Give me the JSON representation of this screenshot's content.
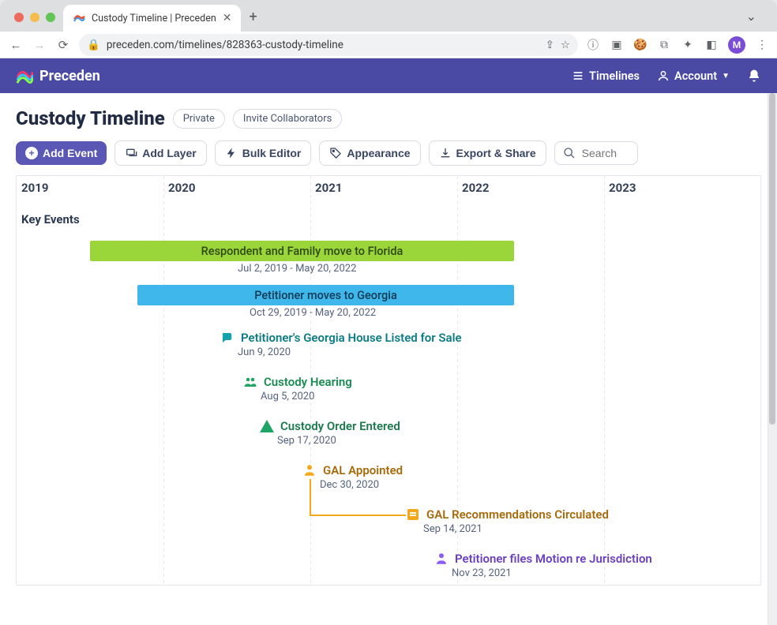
{
  "browser": {
    "tab_title": "Custody Timeline | Preceden",
    "url": "preceden.com/timelines/828363-custody-timeline",
    "avatar_letter": "M"
  },
  "header": {
    "brand": "Preceden",
    "timelines": "Timelines",
    "account": "Account"
  },
  "page": {
    "title": "Custody Timeline",
    "privacy": "Private",
    "invite": "Invite Collaborators"
  },
  "toolbar": {
    "add_event": "Add Event",
    "add_layer": "Add Layer",
    "bulk_editor": "Bulk Editor",
    "appearance": "Appearance",
    "export_share": "Export & Share",
    "search_placeholder": "Search"
  },
  "timeline": {
    "years": [
      "2019",
      "2020",
      "2021",
      "2022",
      "2023"
    ],
    "track_label": "Key Events",
    "bars": [
      {
        "label": "Respondent and Family move to Florida",
        "date": "Jul 2, 2019 - May 20, 2022",
        "start": "2019-07-02",
        "end": "2022-05-20",
        "color": "green"
      },
      {
        "label": "Petitioner moves to Georgia",
        "date": "Oct 29, 2019 - May 20, 2022",
        "start": "2019-10-29",
        "end": "2022-05-20",
        "color": "blue"
      }
    ],
    "points": [
      {
        "label": "Petitioner's Georgia House Listed for Sale",
        "date": "Jun 9, 2020",
        "icon": "comments",
        "color": "teal"
      },
      {
        "label": "Custody Hearing",
        "date": "Aug 5, 2020",
        "icon": "people",
        "color": "green"
      },
      {
        "label": "Custody Order Entered",
        "date": "Sep 17, 2020",
        "icon": "triangle",
        "color": "darkgreen"
      },
      {
        "label": "GAL Appointed",
        "date": "Dec 30, 2020",
        "icon": "person",
        "color": "amber"
      },
      {
        "label": "GAL Recommendations Circulated",
        "date": "Sep 14, 2021",
        "icon": "list",
        "color": "amber"
      },
      {
        "label": "Petitioner files Motion re Jurisdiction",
        "date": "Nov 23, 2021",
        "icon": "person",
        "color": "purple"
      }
    ]
  }
}
